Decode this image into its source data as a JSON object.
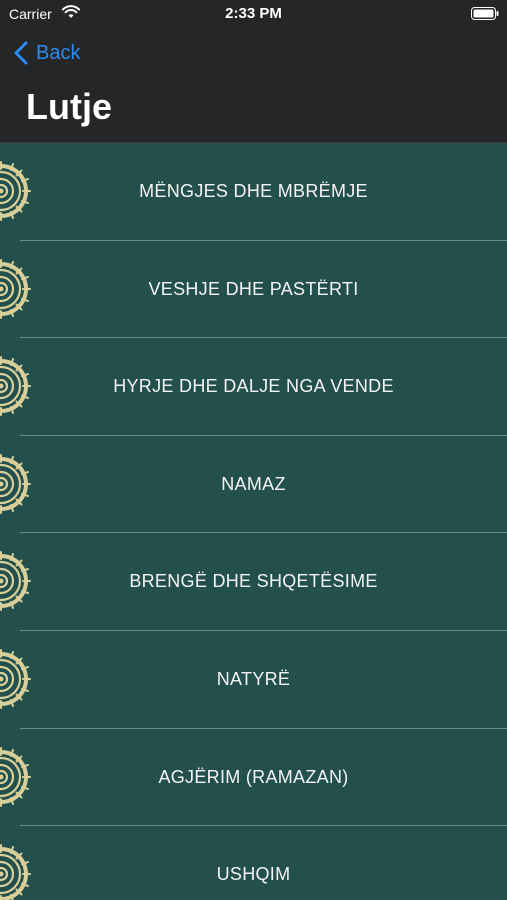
{
  "status_bar": {
    "carrier": "Carrier",
    "time": "2:33 PM",
    "wifi_icon": "wifi-icon",
    "battery_icon": "battery-icon"
  },
  "nav": {
    "back_label": "Back",
    "back_icon": "chevron-left-icon",
    "title": "Lutje"
  },
  "list": {
    "items": [
      {
        "label": "MËNGJES DHE MBRËMJE",
        "icon": "rosette-icon"
      },
      {
        "label": "VESHJE DHE PASTËRTI",
        "icon": "rosette-icon"
      },
      {
        "label": "HYRJE DHE DALJE NGA VENDE",
        "icon": "rosette-icon"
      },
      {
        "label": "NAMAZ",
        "icon": "rosette-icon"
      },
      {
        "label": "BRENGË DHE SHQETËSIME",
        "icon": "rosette-icon"
      },
      {
        "label": "NATYRË",
        "icon": "rosette-icon"
      },
      {
        "label": "AGJËRIM (RAMAZAN)",
        "icon": "rosette-icon"
      },
      {
        "label": "USHQIM",
        "icon": "rosette-icon"
      }
    ]
  },
  "colors": {
    "nav_background": "#252628",
    "list_background": "#234f4c",
    "accent": "#2a8cf2",
    "rosette": "#d9cf9a"
  }
}
